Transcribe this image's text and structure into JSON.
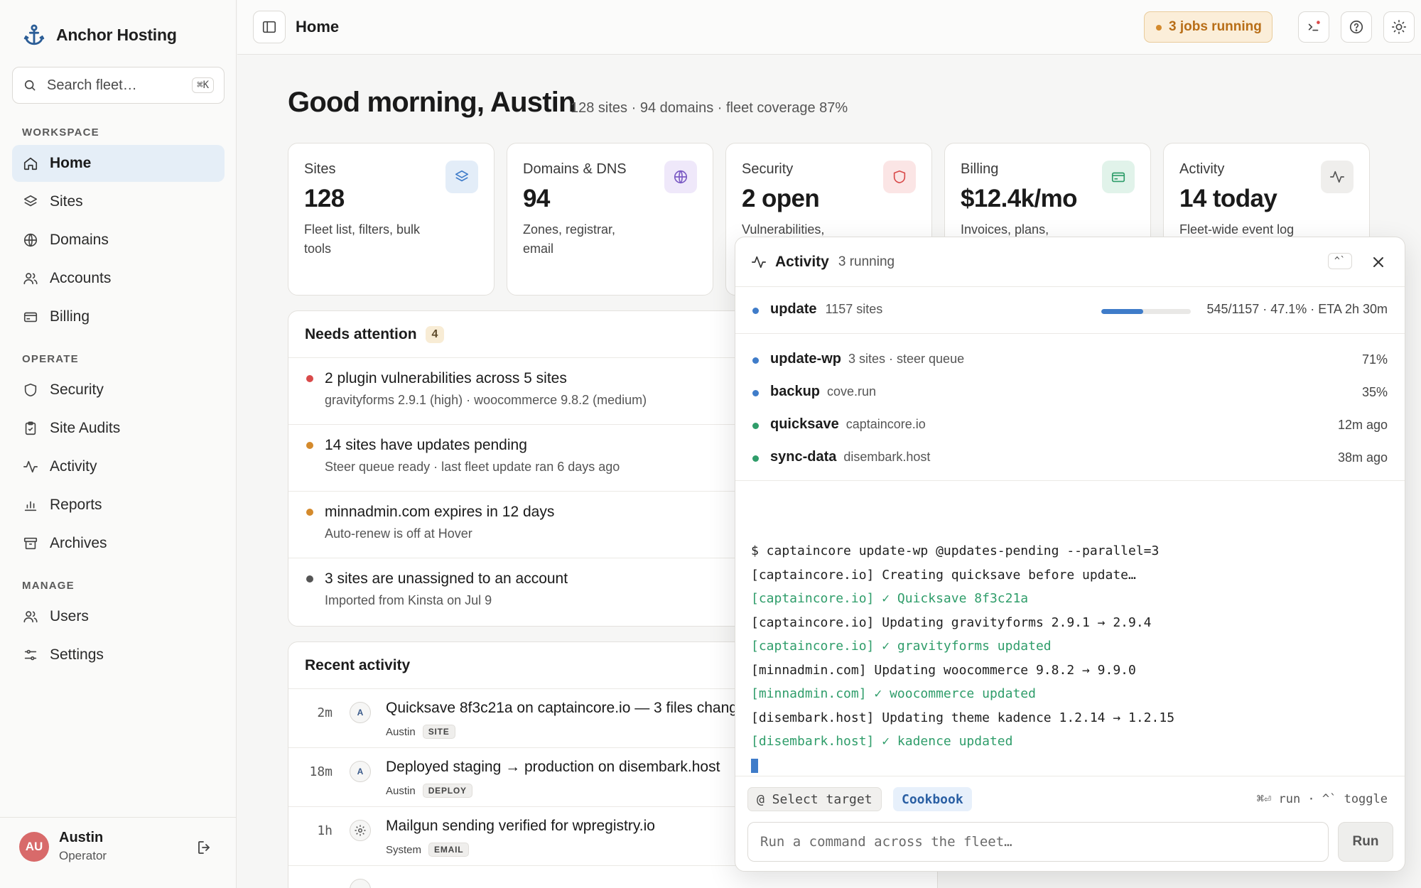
{
  "brand": {
    "name": "Anchor Hosting"
  },
  "search": {
    "placeholder": "Search fleet…",
    "shortcut": "⌘K"
  },
  "sidebar": {
    "sections": [
      {
        "title": "WORKSPACE",
        "items": [
          "Home",
          "Sites",
          "Domains",
          "Accounts",
          "Billing"
        ]
      },
      {
        "title": "OPERATE",
        "items": [
          "Security",
          "Site Audits",
          "Activity",
          "Reports",
          "Archives"
        ]
      },
      {
        "title": "MANAGE",
        "items": [
          "Users",
          "Settings"
        ]
      }
    ],
    "active": "Home"
  },
  "user": {
    "initials": "AU",
    "name": "Austin",
    "role": "Operator"
  },
  "header": {
    "breadcrumb": "Home",
    "jobs_label": "3 jobs running"
  },
  "greeting": {
    "title": "Good morning, Austin",
    "subtitle": "128 sites · 94 domains · fleet coverage 87%"
  },
  "cards": [
    {
      "title": "Sites",
      "value": "128",
      "desc": "Fleet list, filters, bulk tools",
      "icon": "layers-icon",
      "color": "#e3edf8"
    },
    {
      "title": "Domains & DNS",
      "value": "94",
      "desc": "Zones, registrar, email",
      "icon": "globe-icon",
      "color": "#efe8fa"
    },
    {
      "title": "Security",
      "value": "2 open",
      "desc": "Vulnerabilities,",
      "icon": "shield-icon",
      "color": "#fbe5e5"
    },
    {
      "title": "Billing",
      "value": "$12.4k/mo",
      "desc": "Invoices, plans,",
      "icon": "card-icon",
      "color": "#e1f3ea"
    },
    {
      "title": "Activity",
      "value": "14 today",
      "desc": "Fleet-wide event log",
      "icon": "pulse-icon",
      "color": "#efeeec"
    }
  ],
  "attention": {
    "title": "Needs attention",
    "count": "4",
    "items": [
      {
        "title": "2 plugin vulnerabilities across 5 sites",
        "sub": "gravityforms 2.9.1 (high) · woocommerce 9.8.2 (medium)",
        "color": "#d94a4a"
      },
      {
        "title": "14 sites have updates pending",
        "sub": "Steer queue ready · last fleet update ran 6 days ago",
        "color": "#d48a2c"
      },
      {
        "title": "minnadmin.com expires in 12 days",
        "sub": "Auto-renew is off at Hover",
        "color": "#d48a2c"
      },
      {
        "title": "3 sites are unassigned to an account",
        "sub": "Imported from Kinsta on Jul 9",
        "color": "#555555"
      }
    ]
  },
  "recent": {
    "title": "Recent activity",
    "items": [
      {
        "time": "2m",
        "avatar": "A",
        "title": "Quicksave 8f3c21a on captaincore.io — 3 files changed",
        "who": "Austin",
        "tag": "SITE"
      },
      {
        "time": "18m",
        "avatar": "A",
        "title": "Deployed staging → production on disembark.host",
        "who": "Austin",
        "tag": "DEPLOY"
      },
      {
        "time": "1h",
        "avatar": "gear",
        "title": "Mailgun sending verified for wpregistry.io",
        "who": "System",
        "tag": "EMAIL"
      },
      {
        "time": "",
        "avatar": "",
        "title": "",
        "who": "",
        "tag": ""
      }
    ]
  },
  "drawer": {
    "title": "Activity",
    "running": "3 running",
    "toggle_key": "^`",
    "main_job": {
      "name": "update",
      "meta": "1157 sites",
      "progress": 0.471,
      "status": "545/1157 · 47.1% · ETA 2h 30m",
      "color": "#3f7cc9"
    },
    "jobs": [
      {
        "name": "update-wp",
        "meta": "3 sites · steer queue",
        "right": "71%",
        "color": "#3f7cc9"
      },
      {
        "name": "backup",
        "meta": "cove.run",
        "right": "35%",
        "color": "#3f7cc9"
      },
      {
        "name": "quicksave",
        "meta": "captaincore.io",
        "right": "12m ago",
        "color": "#2f9d6a"
      },
      {
        "name": "sync-data",
        "meta": "disembark.host",
        "right": "38m ago",
        "color": "#2f9d6a"
      }
    ],
    "terminal": [
      {
        "text": "$ captaincore update-wp @updates-pending --parallel=3",
        "ok": false
      },
      {
        "text": "[captaincore.io] Creating quicksave before update…",
        "ok": false
      },
      {
        "text": "[captaincore.io] ✓ Quicksave 8f3c21a",
        "ok": true
      },
      {
        "text": "[captaincore.io] Updating gravityforms 2.9.1 → 2.9.4",
        "ok": false
      },
      {
        "text": "[captaincore.io] ✓ gravityforms updated",
        "ok": true
      },
      {
        "text": "[minnadmin.com] Updating woocommerce 9.8.2 → 9.9.0",
        "ok": false
      },
      {
        "text": "[minnadmin.com] ✓ woocommerce updated",
        "ok": true
      },
      {
        "text": "[disembark.host] Updating theme kadence 1.2.14 → 1.2.15",
        "ok": false
      },
      {
        "text": "[disembark.host] ✓ kadence updated",
        "ok": true
      }
    ],
    "select_target": "@ Select target",
    "cookbook": "Cookbook",
    "hint": "⌘⏎ run · ^` toggle",
    "cmd_placeholder": "Run a command across the fleet…",
    "run_label": "Run"
  }
}
